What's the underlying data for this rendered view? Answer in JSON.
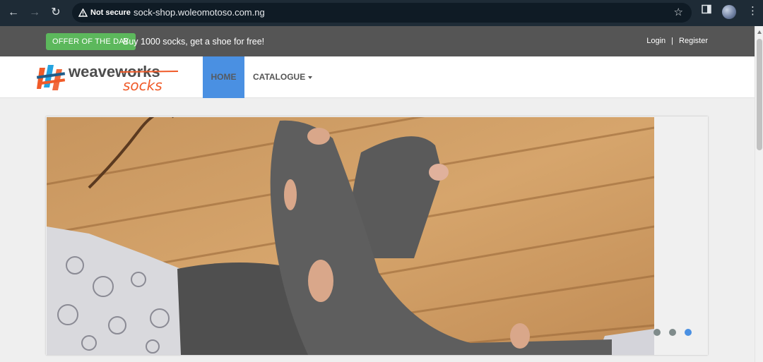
{
  "browser": {
    "security_label": "Not secure",
    "url": "sock-shop.woleomotoso.com.ng"
  },
  "topbar": {
    "offer_badge": "OFFER OF THE DAY",
    "offer_text": "Buy 1000 socks, get a shoe for free!",
    "login": "Login",
    "separator": "|",
    "register": "Register"
  },
  "navbar": {
    "logo_top": "weaveworks",
    "logo_bottom": "socks",
    "home": "HOME",
    "catalogue": "CATALOGUE"
  },
  "carousel": {
    "slide_count": 3,
    "active_index": 2
  },
  "colors": {
    "accent": "#4a90e2",
    "offer_green": "#5cb85c",
    "topbar": "#555555",
    "logo_orange": "#f05a28",
    "logo_blue": "#24a3e0"
  }
}
